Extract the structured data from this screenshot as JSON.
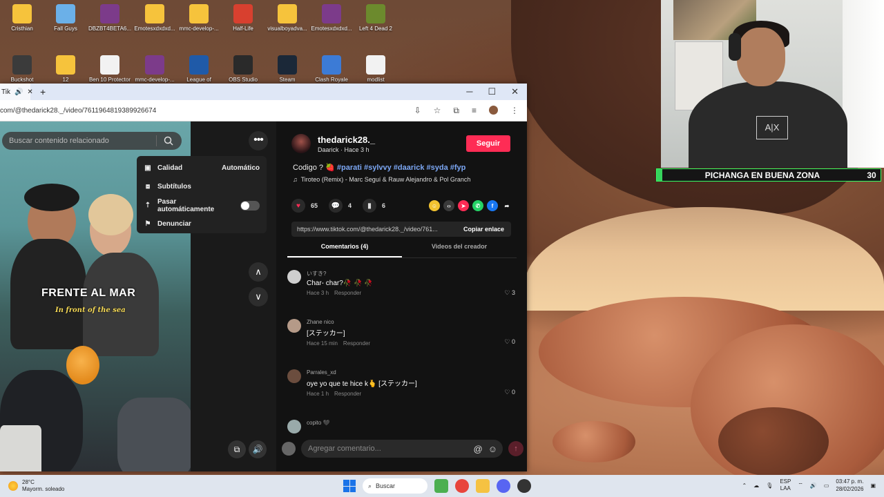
{
  "desktop": {
    "icons_row1": [
      "Cristhian",
      "Fall Guys",
      "DBZBT4BETA6...",
      "Emotesxdxdxd...",
      "mmc-develop-...",
      "Half-Life",
      "visualboyadva...",
      "Emotesxdxdxd...",
      "Left 4 Dead 2"
    ],
    "icons_row2": [
      "Buckshot",
      "12",
      "Ben 10 Protector",
      "mmc-develop-...",
      "League of",
      "OBS Studio",
      "Steam",
      "Clash Royale",
      "modlist"
    ]
  },
  "stream_banner": {
    "title": "PICHANGA EN BUENA ZONA",
    "score": "30"
  },
  "browser": {
    "tab_title": "Tik",
    "address": "com/@thedarick28._/video/7611964819389926674"
  },
  "player": {
    "search_placeholder": "Buscar contenido relacionado",
    "caption": "FRENTE AL MAR",
    "subcaption": "In front of the sea",
    "menu": {
      "quality_label": "Calidad",
      "quality_value": "Automático",
      "subtitles_label": "Subtítulos",
      "autoplay_label": "Pasar automáticamente",
      "report_label": "Denunciar"
    }
  },
  "post": {
    "author": "thedarick28._",
    "author_sub": "Daarick · Hace 3 h",
    "follow_label": "Seguir",
    "description": "Codigo ? 🍓",
    "hashtags": "#parati #sylvvy #daarick #syda #fyp",
    "music": "Tiroteo (Remix) - Marc Seguí & Rauw Alejandro & Pol Granch",
    "likes": "65",
    "comments_count": "4",
    "saves": "6",
    "link": "https://www.tiktok.com/@thedarick28._/video/761...",
    "copy_label": "Copiar enlace",
    "tab_comments": "Comentarios (4)",
    "tab_creator": "Videos del creador"
  },
  "comments": [
    {
      "user": "いすき?",
      "text": "Char- char?🥀 🥀 🥀",
      "time": "Hace 3 h",
      "reply": "Responder",
      "likes": "3"
    },
    {
      "user": "Zhane nico",
      "text": "[ステッカー]",
      "time": "Hace 15 min",
      "reply": "Responder",
      "likes": "0"
    },
    {
      "user": "Parrales_xd",
      "text": "oye yo que te hice k🫰 [ステッカー]",
      "time": "Hace 1 h",
      "reply": "Responder",
      "likes": "0"
    },
    {
      "user": "copito 🖤",
      "text": "",
      "time": "",
      "reply": "",
      "likes": ""
    }
  ],
  "add_comment_placeholder": "Agregar comentario...",
  "taskbar": {
    "temp": "28°C",
    "weather": "Mayorm. soleado",
    "search": "Buscar",
    "lang1": "ESP",
    "lang2": "LAA",
    "time": "03:47 p. m.",
    "date": "28/02/2026"
  },
  "colors": {
    "accent": "#fe2c55",
    "hashtag": "#7ca7f4",
    "banner_green": "#36d35c"
  }
}
